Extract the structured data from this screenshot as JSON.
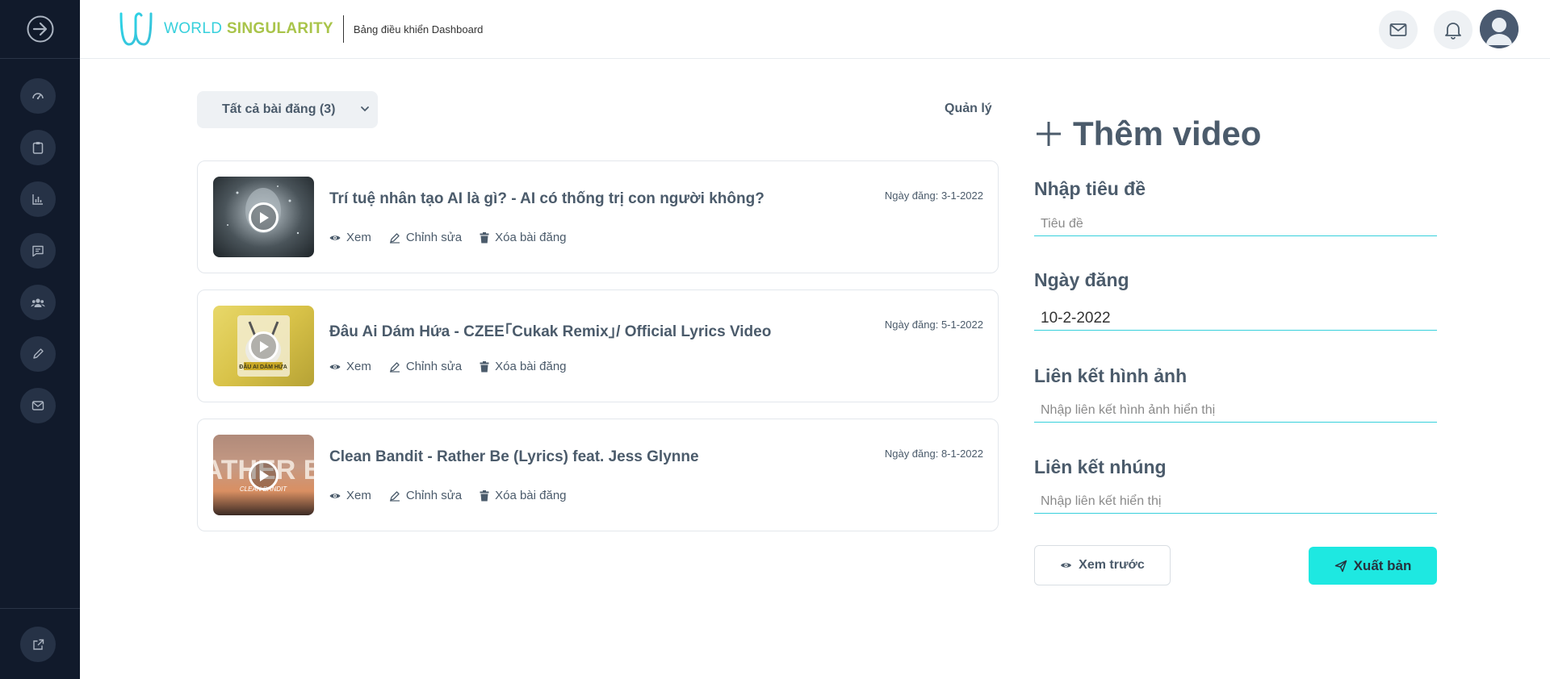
{
  "header": {
    "brand_part1": "WORLD",
    "brand_part2": "SINGULARITY",
    "subtitle": "Bảng điều khiển Dashboard"
  },
  "sidebar": {
    "items": [
      {
        "icon": "dashboard-gauge-icon"
      },
      {
        "icon": "clipboard-icon"
      },
      {
        "icon": "bar-chart-icon"
      },
      {
        "icon": "message-icon"
      },
      {
        "icon": "users-icon"
      },
      {
        "icon": "pencil-icon"
      },
      {
        "icon": "mail-icon"
      }
    ],
    "bottom_icon": "external-link-icon"
  },
  "list": {
    "filter_label": "Tất cả bài đăng (3)",
    "manage_label": "Quản lý",
    "actions": {
      "view": "Xem",
      "edit": "Chỉnh sửa",
      "delete": "Xóa bài đăng"
    },
    "posts": [
      {
        "title": "Trí tuệ nhân tạo AI là gì? - AI có thống trị con người không?",
        "date": "Ngày đăng: 3-1-2022"
      },
      {
        "title": "Đâu Ai Dám Hứa - CZEE｢Cukak Remix｣/ Official Lyrics Video",
        "date": "Ngày đăng: 5-1-2022"
      },
      {
        "title": "Clean Bandit - Rather Be (Lyrics) feat. Jess Glynne",
        "date": "Ngày đăng: 8-1-2022"
      }
    ]
  },
  "form": {
    "heading": "Thêm video",
    "title_label": "Nhập tiêu đề",
    "title_placeholder": "Tiêu đề",
    "date_label": "Ngày đăng",
    "date_value": "10-2-2022",
    "image_label": "Liên kết hình ảnh",
    "image_placeholder": "Nhập liên kết hình ảnh hiển thị",
    "embed_label": "Liên kết nhúng",
    "embed_placeholder": "Nhập liên kết hiển thị",
    "preview_button": "Xem trước",
    "publish_button": "Xuất bản"
  },
  "colors": {
    "sidebar_bg": "#111a2b",
    "accent_cyan": "#1ee8e1",
    "brand_green": "#a9c44a",
    "text": "#4b5b6b"
  }
}
